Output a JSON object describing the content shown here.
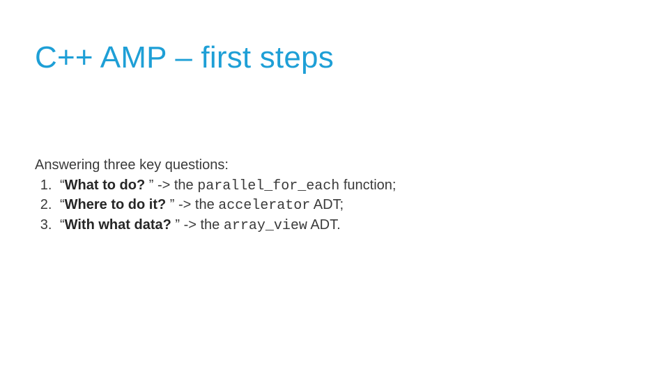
{
  "title": "C++ AMP – first steps",
  "intro": "Answering three key questions:",
  "items": [
    {
      "q": "What to do? ",
      "mid": " -> the ",
      "code": "parallel_for_each",
      "tail": " function;"
    },
    {
      "q": "Where to do it? ",
      "mid": " -> the ",
      "code": "accelerator",
      "tail": " ADT;"
    },
    {
      "q": "With what data? ",
      "mid": " -> the ",
      "code": "array_view",
      "tail": " ADT."
    }
  ]
}
